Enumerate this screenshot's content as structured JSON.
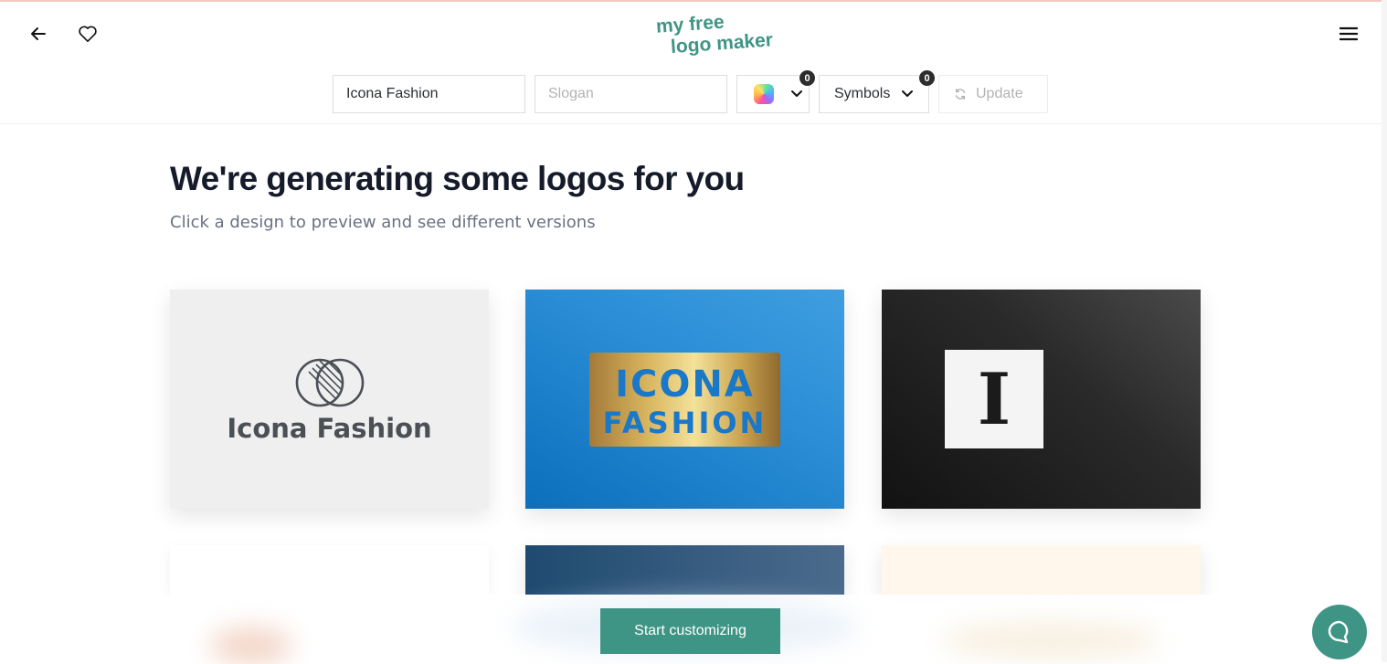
{
  "brand": {
    "line1": "my free",
    "line2": "logo maker",
    "color": "#3f9585"
  },
  "toolbar": {
    "name_value": "Icona Fashion",
    "slogan_placeholder": "Slogan",
    "color_count": "0",
    "symbols_label": "Symbols",
    "symbols_count": "0",
    "update_label": "Update"
  },
  "main": {
    "title": "We're generating some logos for you",
    "subtitle": "Click a design to preview and see different versions"
  },
  "logos": [
    {
      "text": "Icona Fashion"
    },
    {
      "line1": "ICONA",
      "line2": "FASHION"
    },
    {
      "letter": "I"
    }
  ],
  "cta": {
    "label": "Start customizing"
  },
  "icons": {
    "back": "arrow-left-icon",
    "favorite": "heart-icon",
    "menu": "hamburger-menu-icon",
    "chevron": "chevron-down-icon",
    "refresh": "refresh-icon",
    "chat": "chat-bubble-icon"
  },
  "colors": {
    "accent": "#3f9585",
    "text_dark": "#151b2a",
    "text_muted": "#6b7080"
  }
}
